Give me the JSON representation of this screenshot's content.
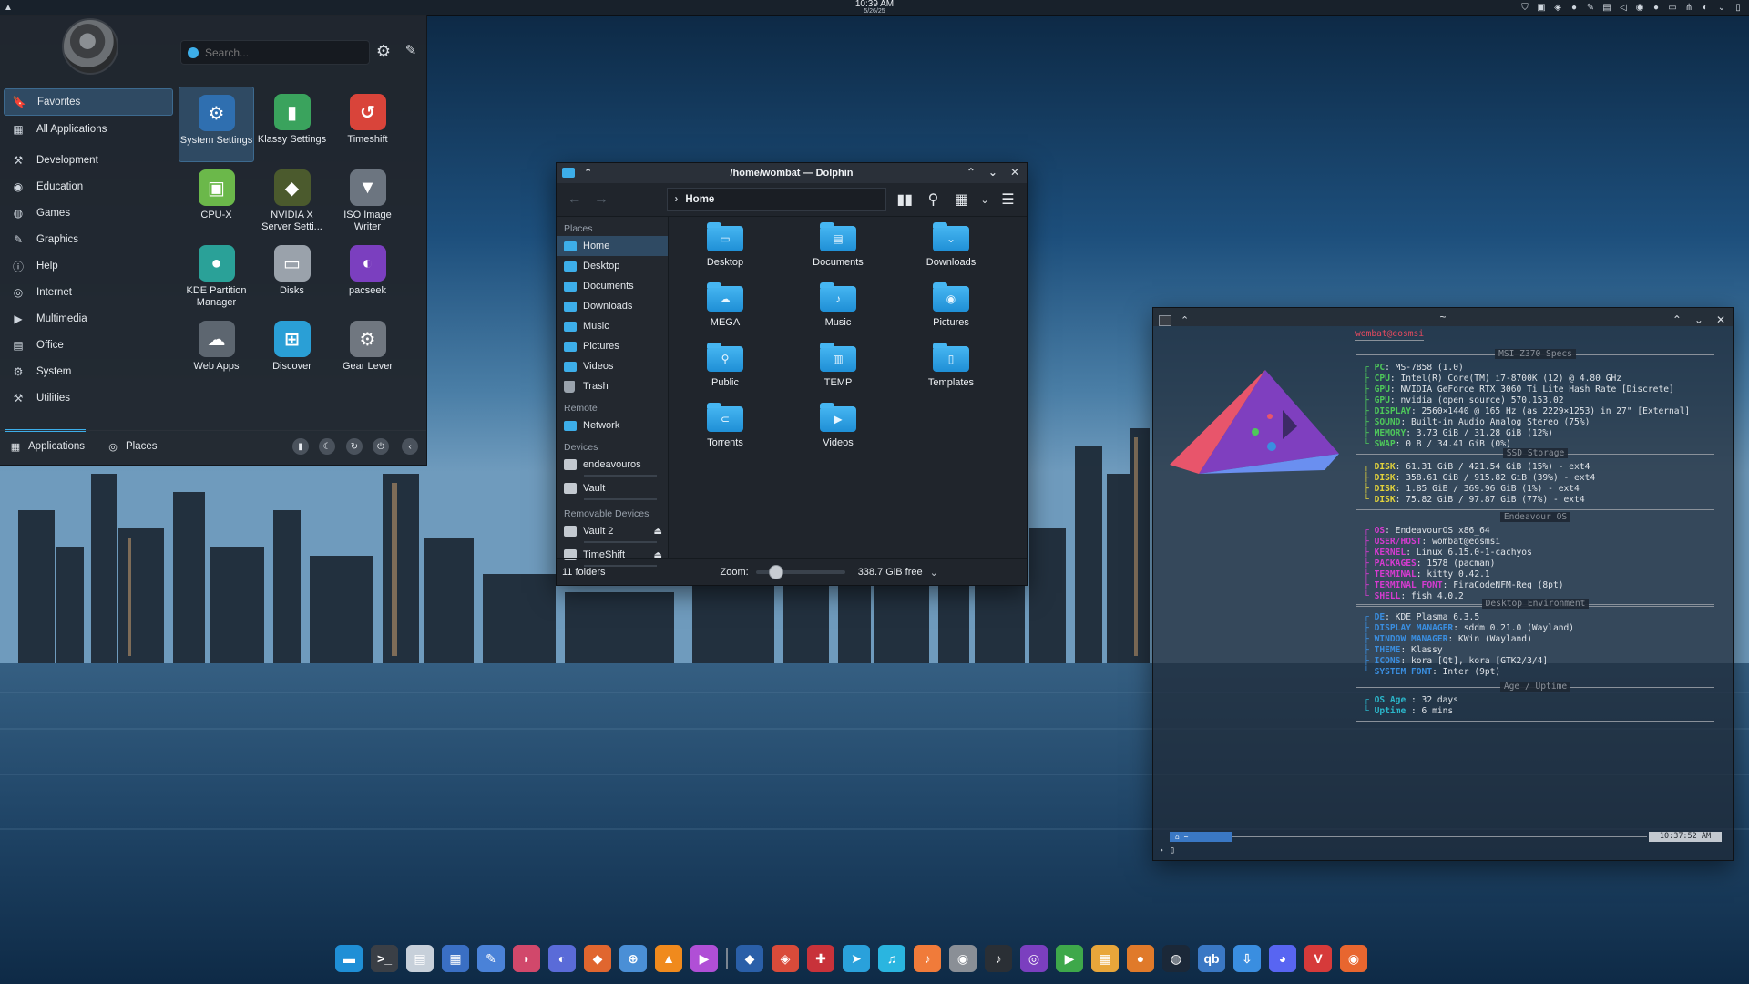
{
  "top_panel": {
    "time": "10:39 AM",
    "date": "5/26/25"
  },
  "launcher": {
    "search_placeholder": "Search...",
    "categories": [
      {
        "label": "Favorites",
        "icon": "bookmark-icon"
      },
      {
        "label": "All Applications",
        "icon": "grid-icon"
      },
      {
        "label": "Development",
        "icon": "development-icon"
      },
      {
        "label": "Education",
        "icon": "education-icon"
      },
      {
        "label": "Games",
        "icon": "gamepad-icon"
      },
      {
        "label": "Graphics",
        "icon": "graphics-icon"
      },
      {
        "label": "Help",
        "icon": "help-icon"
      },
      {
        "label": "Internet",
        "icon": "globe-icon"
      },
      {
        "label": "Multimedia",
        "icon": "multimedia-icon"
      },
      {
        "label": "Office",
        "icon": "office-icon"
      },
      {
        "label": "System",
        "icon": "system-icon"
      },
      {
        "label": "Utilities",
        "icon": "utilities-icon"
      }
    ],
    "apps": [
      {
        "label": "System Settings",
        "icon": "system-settings-icon",
        "color": "#2f6fb0"
      },
      {
        "label": "Klassy Settings",
        "icon": "klassy-icon",
        "color": "#3aa35d"
      },
      {
        "label": "Timeshift",
        "icon": "timeshift-icon",
        "color": "#d9443a"
      },
      {
        "label": "CPU-X",
        "icon": "cpu-x-icon",
        "color": "#6bb84a"
      },
      {
        "label": "NVIDIA X Server Setti...",
        "icon": "nvidia-icon",
        "color": "#4b5a2d"
      },
      {
        "label": "ISO Image Writer",
        "icon": "iso-writer-icon",
        "color": "#6c7580"
      },
      {
        "label": "KDE Partition Manager",
        "icon": "partition-manager-icon",
        "color": "#2aa198"
      },
      {
        "label": "Disks",
        "icon": "disks-icon",
        "color": "#9aa2ab"
      },
      {
        "label": "pacseek",
        "icon": "pacseek-icon",
        "color": "#7b3fbf"
      },
      {
        "label": "Web Apps",
        "icon": "web-apps-icon",
        "color": "#5d6670"
      },
      {
        "label": "Discover",
        "icon": "discover-icon",
        "color": "#2a9fd6"
      },
      {
        "label": "Gear Lever",
        "icon": "gear-lever-icon",
        "color": "#707780"
      }
    ],
    "tabs": {
      "applications": "Applications",
      "places": "Places"
    }
  },
  "dolphin": {
    "title": "/home/wombat — Dolphin",
    "breadcrumb": "Home",
    "sidebar": {
      "places_heading": "Places",
      "places": [
        "Home",
        "Desktop",
        "Documents",
        "Downloads",
        "Music",
        "Pictures",
        "Videos",
        "Trash"
      ],
      "remote_heading": "Remote",
      "remote": [
        "Network"
      ],
      "devices_heading": "Devices",
      "devices": [
        "endeavouros",
        "Vault"
      ],
      "removable_heading": "Removable Devices",
      "removable": [
        "Vault 2",
        "TimeShift"
      ]
    },
    "folders": [
      {
        "label": "Desktop",
        "glyph": "▭"
      },
      {
        "label": "Documents",
        "glyph": "▤"
      },
      {
        "label": "Downloads",
        "glyph": "⌄"
      },
      {
        "label": "MEGA",
        "glyph": "☁"
      },
      {
        "label": "Music",
        "glyph": "♪"
      },
      {
        "label": "Pictures",
        "glyph": "◉"
      },
      {
        "label": "Public",
        "glyph": "⚲"
      },
      {
        "label": "TEMP",
        "glyph": "▥"
      },
      {
        "label": "Templates",
        "glyph": "▯"
      },
      {
        "label": "Torrents",
        "glyph": "⊂"
      },
      {
        "label": "Videos",
        "glyph": "▶"
      }
    ],
    "status": {
      "count": "11 folders",
      "zoom_label": "Zoom:",
      "zoom_level": 0.22,
      "free": "338.7 GiB free"
    }
  },
  "terminal": {
    "title": "~",
    "header": "wombat@eosmsi",
    "sections": [
      {
        "title": "MSI Z370 Specs",
        "color": "#4ec85a",
        "lines": [
          {
            "k": "PC",
            "v": ": MS-7B58 (1.0)"
          },
          {
            "k": "CPU",
            "v": ": Intel(R) Core(TM) i7-8700K (12) @ 4.80 GHz"
          },
          {
            "k": "GPU",
            "v": ": NVIDIA GeForce RTX 3060 Ti Lite Hash Rate [Discrete]"
          },
          {
            "k": "GPU",
            "v": ": nvidia (open source) 570.153.02"
          },
          {
            "k": "DISPLAY",
            "v": ": 2560×1440 @ 165 Hz (as 2229×1253) in 27\" [External]"
          },
          {
            "k": "SOUND",
            "v": ": Built-in Audio Analog Stereo (75%)"
          },
          {
            "k": "MEMORY",
            "v": ": 3.73 GiB / 31.28 GiB (12%)"
          },
          {
            "k": "SWAP",
            "v": ": 0 B / 34.41 GiB (0%)"
          }
        ]
      },
      {
        "title": "SSD Storage",
        "color": "#e3d33b",
        "lines": [
          {
            "k": "DISK",
            "v": ": 61.31 GiB / 421.54 GiB (15%) - ext4"
          },
          {
            "k": "DISK",
            "v": ": 358.61 GiB / 915.82 GiB (39%) - ext4"
          },
          {
            "k": "DISK",
            "v": ": 1.85 GiB / 369.96 GiB (1%) - ext4"
          },
          {
            "k": "DISK",
            "v": ": 75.82 GiB / 97.87 GiB (77%) - ext4"
          }
        ]
      },
      {
        "title": "Endeavour OS",
        "color": "#d63bd1",
        "lines": [
          {
            "k": "OS",
            "v": ": EndeavourOS x86_64"
          },
          {
            "k": "USER/HOST",
            "v": ": wombat@eosmsi"
          },
          {
            "k": "KERNEL",
            "v": ": Linux 6.15.0-1-cachyos"
          },
          {
            "k": "PACKAGES",
            "v": ": 1578 (pacman)"
          },
          {
            "k": "TERMINAL",
            "v": ": kitty 0.42.1"
          },
          {
            "k": "TERMINAL FONT",
            "v": ": FiraCodeNFM-Reg (8pt)"
          },
          {
            "k": "SHELL",
            "v": ": fish 4.0.2"
          }
        ]
      },
      {
        "title": "Desktop Environment",
        "color": "#3a8ee0",
        "lines": [
          {
            "k": "DE",
            "v": ": KDE Plasma 6.3.5"
          },
          {
            "k": "DISPLAY MANAGER",
            "v": ": sddm 0.21.0 (Wayland)"
          },
          {
            "k": "WINDOW MANAGER",
            "v": ": KWin (Wayland)"
          },
          {
            "k": "THEME",
            "v": ": Klassy"
          },
          {
            "k": "ICONS",
            "v": ": kora [Qt], kora [GTK2/3/4]"
          },
          {
            "k": "SYSTEM FONT",
            "v": ": Inter (9pt)"
          }
        ]
      },
      {
        "title": "Age / Uptime",
        "color": "#2bb5c9",
        "lines": [
          {
            "k": "OS Age",
            "v": " : 32 days"
          },
          {
            "k": "Uptime",
            "v": " : 6 mins"
          }
        ]
      }
    ],
    "prompt_left": "⌂ ~",
    "prompt_time": "10:37:52 AM"
  },
  "taskbar": [
    {
      "name": "dolphin-task",
      "color": "#1f8fd6"
    },
    {
      "name": "terminal-task",
      "color": "#3a3f46"
    },
    {
      "name": "text-editor-task",
      "color": "#c7d0da"
    },
    {
      "name": "office-task",
      "color": "#3a6fc4"
    },
    {
      "name": "notes-task",
      "color": "#4a82d8"
    },
    {
      "name": "browser-task",
      "color": "#d1486b"
    },
    {
      "name": "media-task",
      "color": "#5a6bd8"
    },
    {
      "name": "firefox-dev-task",
      "color": "#e0662f"
    },
    {
      "name": "kde-connect-task",
      "color": "#4a8fd6"
    },
    {
      "name": "vlc-task",
      "color": "#f08a1d"
    },
    {
      "name": "player-task",
      "color": "#b04fd6"
    },
    {
      "name": "separator",
      "color": ""
    },
    {
      "name": "blue-app-task",
      "color": "#2a5fa8"
    },
    {
      "name": "lutris-task",
      "color": "#d94b3a"
    },
    {
      "name": "grid-app-task",
      "color": "#c8323a"
    },
    {
      "name": "telegram-task",
      "color": "#2aa1db"
    },
    {
      "name": "music-app-task",
      "color": "#2ab5e0"
    },
    {
      "name": "audio-app-task",
      "color": "#f07b3a"
    },
    {
      "name": "disc-task",
      "color": "#8a8f96"
    },
    {
      "name": "spotify-task",
      "color": "#2a2f35"
    },
    {
      "name": "tidal-task",
      "color": "#7b3fbf"
    },
    {
      "name": "play-task",
      "color": "#3ea84a"
    },
    {
      "name": "files-task",
      "color": "#e8a63a"
    },
    {
      "name": "blender-task",
      "color": "#e07a2a"
    },
    {
      "name": "steam-task",
      "color": "#1b2838"
    },
    {
      "name": "qbittorrent-task",
      "color": "#3a78c4"
    },
    {
      "name": "download-task",
      "color": "#3a8ee0"
    },
    {
      "name": "discord-task",
      "color": "#5865f2"
    },
    {
      "name": "vivaldi-task",
      "color": "#d63a3a"
    },
    {
      "name": "firefox-task",
      "color": "#e8662f"
    }
  ],
  "colors": {
    "accent": "#3daee9",
    "selection": "#2f4a63"
  }
}
